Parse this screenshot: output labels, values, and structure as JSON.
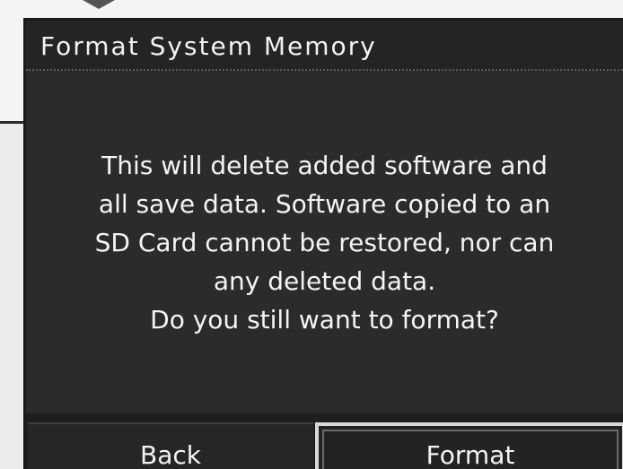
{
  "dialog": {
    "title": "Format System Memory",
    "message_lines": [
      "This will delete added software and",
      "all save data. Software copied to an",
      "SD Card cannot be restored, nor can",
      "any deleted data.",
      "Do you still want to format?"
    ],
    "buttons": {
      "back_label": "Back",
      "format_label": "Format"
    }
  },
  "colors": {
    "dialog_background": "#2b2b2b",
    "text": "#f4f4f4",
    "selected_button_border": "#d9d9d9"
  }
}
